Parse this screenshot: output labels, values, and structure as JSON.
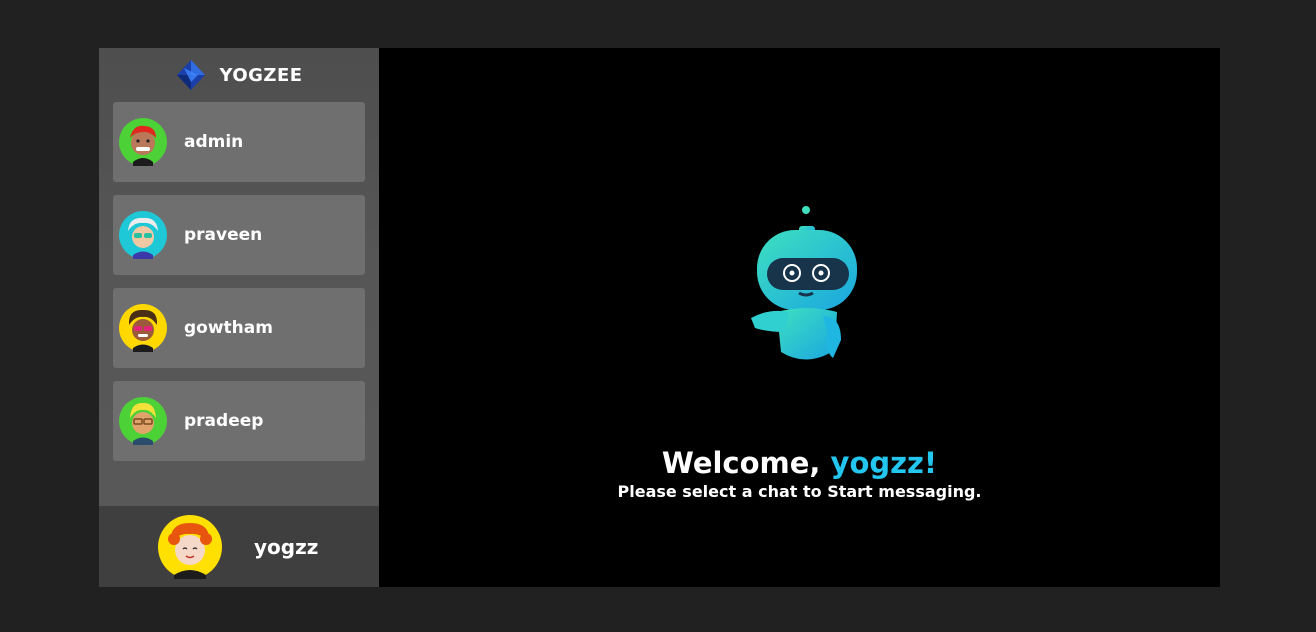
{
  "brand": {
    "title": "YOGZEE",
    "icon": "diamond-logo-icon"
  },
  "contacts": [
    {
      "name": "admin",
      "avatar_bg": "#4cd137",
      "hair": "#e0281e"
    },
    {
      "name": "praveen",
      "avatar_bg": "#1ec8d6",
      "hair": "#e8e8e8"
    },
    {
      "name": "gowtham",
      "avatar_bg": "#ffd800",
      "hair": "#5a3a1a"
    },
    {
      "name": "pradeep",
      "avatar_bg": "#4cd137",
      "hair": "#f2e23a"
    }
  ],
  "current_user": {
    "name": "yogzz",
    "avatar_bg": "#ffe000",
    "hair": "#e8550e"
  },
  "welcome": {
    "greeting": "Welcome, ",
    "name": "yogzz!",
    "subtitle": "Please select a chat to Start messaging."
  },
  "colors": {
    "accent": "#22c6ee",
    "sidebar": "#595959",
    "card": "#6f6f6f",
    "background": "#212121"
  }
}
